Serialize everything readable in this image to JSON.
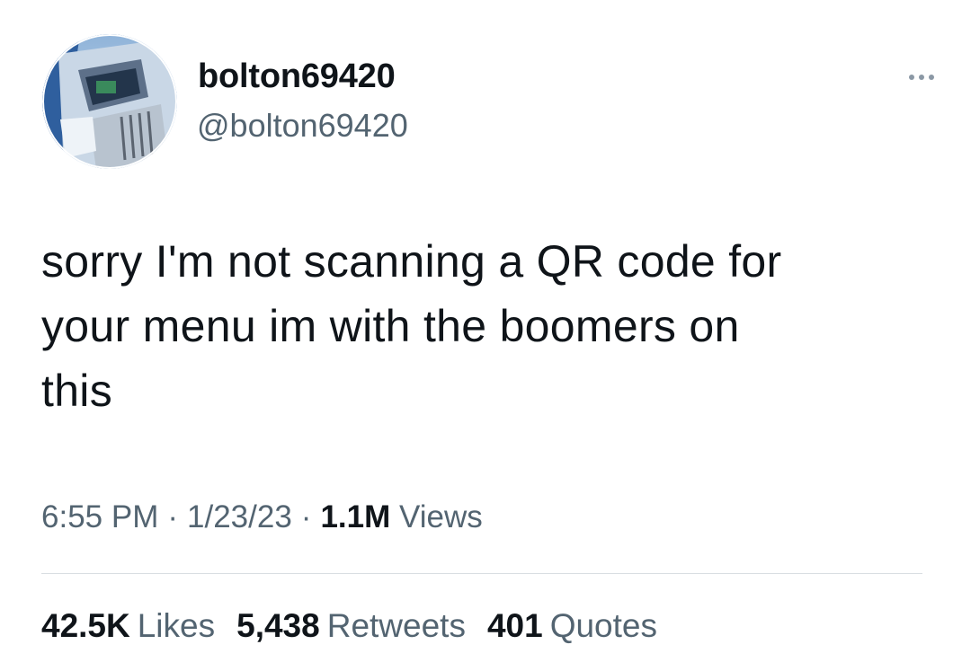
{
  "user": {
    "display_name": "bolton69420",
    "handle": "@bolton69420",
    "avatar_icon": "truck-avatar-photo"
  },
  "more_icon": "ellipsis-icon",
  "tweet": {
    "lines": [
      "sorry I'm not scanning a QR code for",
      "your menu im with the boomers on",
      "this"
    ]
  },
  "meta": {
    "time": "6:55 PM",
    "separator": "·",
    "date": "1/23/23",
    "views_count": "1.1M",
    "views_label": "Views"
  },
  "stats": {
    "likes": {
      "count": "42.5K",
      "label": "Likes"
    },
    "retweets": {
      "count": "5,438",
      "label": "Retweets"
    },
    "quotes": {
      "count": "401",
      "label": "Quotes"
    }
  },
  "colors": {
    "text_primary": "#0f1419",
    "text_secondary": "#536471",
    "divider": "#d9dee2",
    "background": "#ffffff"
  }
}
